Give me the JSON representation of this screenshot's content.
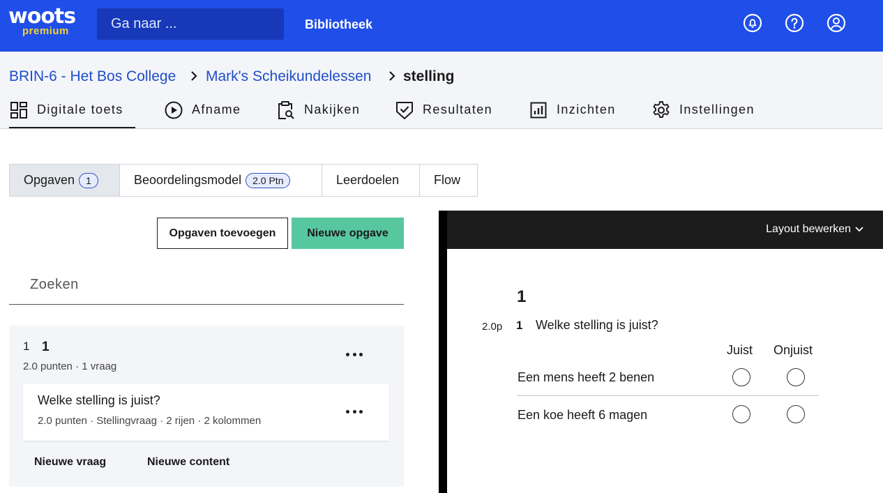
{
  "brand": {
    "name": "woots",
    "tier": "premium"
  },
  "top": {
    "search_placeholder": "Ga naar ...",
    "library": "Bibliotheek",
    "icons": [
      "bell-icon",
      "help-icon",
      "account-icon"
    ]
  },
  "breadcrumb": {
    "school": "BRIN-6 - Het Bos College",
    "course": "Mark's Scheikundelessen",
    "current": "stelling"
  },
  "nav": {
    "tabs": [
      {
        "label": "Digitale toets",
        "icon": "dashboard-icon",
        "active": true
      },
      {
        "label": "Afname",
        "icon": "play-icon"
      },
      {
        "label": "Nakijken",
        "icon": "clipboard-search-icon"
      },
      {
        "label": "Resultaten",
        "icon": "shield-check-icon"
      },
      {
        "label": "Inzichten",
        "icon": "bar-chart-icon"
      },
      {
        "label": "Instellingen",
        "icon": "gear-icon"
      }
    ]
  },
  "subtabs": {
    "opgaven": "Opgaven",
    "opgaven_count": "1",
    "model": "Beoordelingsmodel",
    "model_points": "2.0 Ptn",
    "leerdoelen": "Leerdoelen",
    "flow": "Flow"
  },
  "actions": {
    "add_existing": "Opgaven toevoegen",
    "new_task": "Nieuwe opgave"
  },
  "search": {
    "placeholder": "Zoeken"
  },
  "group": {
    "index": "1",
    "name": "1",
    "meta": "2.0 punten · 1 vraag",
    "question": {
      "title": "Welke stelling is juist?",
      "meta": "2.0 punten · Stellingvraag · 2 rijen · 2 kolommen"
    },
    "new_question": "Nieuwe vraag",
    "new_content": "Nieuwe content"
  },
  "preview": {
    "layout_button": "Layout bewerken",
    "number": "1",
    "points": "2.0p",
    "question_number": "1",
    "question": "Welke stelling is juist?",
    "columns": [
      "Juist",
      "Onjuist"
    ],
    "rows": [
      "Een mens heeft 2 benen",
      "Een koe heeft 6 magen"
    ]
  }
}
